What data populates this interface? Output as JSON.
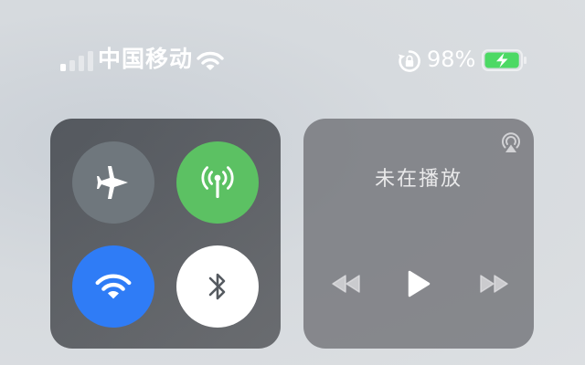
{
  "status_bar": {
    "carrier": "中国移动",
    "battery_percent": "98%",
    "signal_bars_active": 1,
    "signal_bars_total": 4,
    "battery_level": 0.98,
    "battery_charging": true,
    "icons": [
      "signal-icon",
      "wifi-icon",
      "rotation-lock-icon",
      "battery-icon"
    ]
  },
  "connectivity": {
    "airplane_mode": {
      "icon": "airplane-icon",
      "on": false
    },
    "cellular_data": {
      "icon": "antenna-icon",
      "on": true
    },
    "wifi": {
      "icon": "wifi-icon",
      "on": true
    },
    "bluetooth": {
      "icon": "bluetooth-icon",
      "on": false
    }
  },
  "now_playing": {
    "title": "未在播放",
    "controls": [
      "rewind-icon",
      "play-icon",
      "fast-forward-icon"
    ],
    "airplay_icon": "airplay-icon"
  },
  "colors": {
    "cellular_on": "#5cc163",
    "wifi_on": "#2f7cf6",
    "airplane_off": "#6f777d",
    "bluetooth_off": "#ffffff",
    "battery_fill": "#4cd964"
  }
}
